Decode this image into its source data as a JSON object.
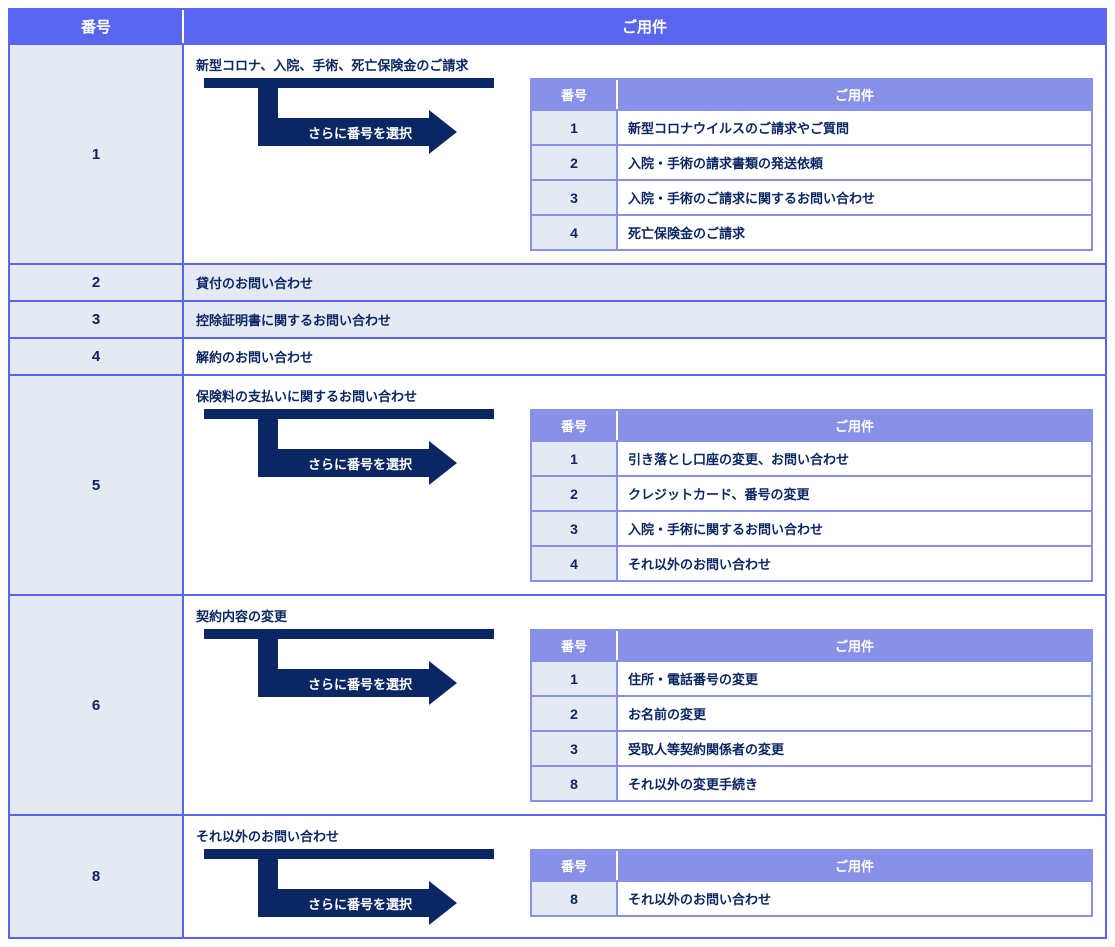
{
  "headers": {
    "num": "番号",
    "label": "ご用件"
  },
  "subheaders": {
    "num": "番号",
    "label": "ご用件"
  },
  "flow_label": "さらに番号を選択",
  "rows": [
    {
      "num": "1",
      "topic": "新型コロナ、入院、手術、死亡保険金のご請求",
      "sub": [
        {
          "n": "1",
          "t": "新型コロナウイルスのご請求やご質問"
        },
        {
          "n": "2",
          "t": "入院・手術の請求書類の発送依頼"
        },
        {
          "n": "3",
          "t": "入院・手術のご請求に関するお問い合わせ"
        },
        {
          "n": "4",
          "t": "死亡保険金のご請求"
        }
      ]
    },
    {
      "num": "2",
      "topic": "貸付のお問い合わせ",
      "simple": true,
      "stripe": true
    },
    {
      "num": "3",
      "topic": "控除証明書に関するお問い合わせ",
      "simple": true,
      "stripe": true
    },
    {
      "num": "4",
      "topic": "解約のお問い合わせ",
      "simple": true
    },
    {
      "num": "5",
      "topic": "保険料の支払いに関するお問い合わせ",
      "sub": [
        {
          "n": "1",
          "t": "引き落とし口座の変更、お問い合わせ"
        },
        {
          "n": "2",
          "t": "クレジットカード、番号の変更"
        },
        {
          "n": "3",
          "t": "入院・手術に関するお問い合わせ"
        },
        {
          "n": "4",
          "t": "それ以外のお問い合わせ"
        }
      ]
    },
    {
      "num": "6",
      "topic": "契約内容の変更",
      "sub": [
        {
          "n": "1",
          "t": "住所・電話番号の変更"
        },
        {
          "n": "2",
          "t": "お名前の変更"
        },
        {
          "n": "3",
          "t": "受取人等契約関係者の変更"
        },
        {
          "n": "8",
          "t": "それ以外の変更手続き"
        }
      ]
    },
    {
      "num": "8",
      "topic": "それ以外のお問い合わせ",
      "sub": [
        {
          "n": "8",
          "t": "それ以外のお問い合わせ"
        }
      ]
    }
  ]
}
